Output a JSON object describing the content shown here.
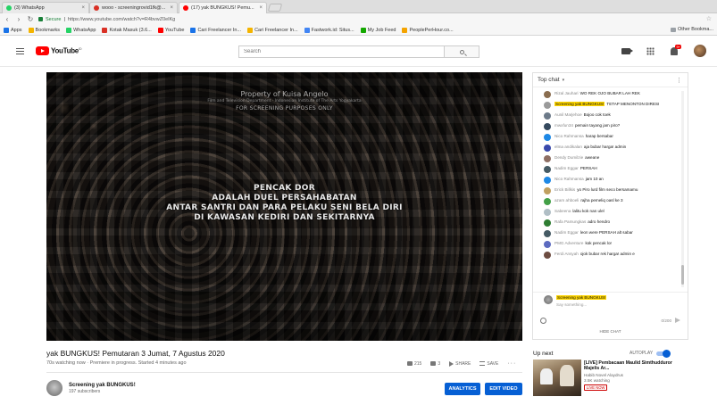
{
  "browser": {
    "tabs": [
      {
        "title": "(3) WhatsApp",
        "icon_color": "#25d366"
      },
      {
        "title": "wooo - screeningrovid1fk@...",
        "icon_color": "#d93025"
      },
      {
        "title": "(17) yak BUNGKUS! Pemu...",
        "icon_color": "#ff0000"
      }
    ],
    "tab_close": "×",
    "secure_label": "Secure",
    "url": "https://www.youtube.com/watch?v=R4bvwZ0elKg",
    "bookmarks": [
      {
        "label": "Apps",
        "icon_color": "#1a73e8"
      },
      {
        "label": "Bookmarks",
        "icon_color": "#f4b400"
      },
      {
        "label": "WhatsApp",
        "icon_color": "#25d366"
      },
      {
        "label": "Kotak Masuk (3.6...",
        "icon_color": "#d93025"
      },
      {
        "label": "YouTube",
        "icon_color": "#ff0000"
      },
      {
        "label": "Cari Freelancer In...",
        "icon_color": "#1a73e8"
      },
      {
        "label": "Cari Freelancer In...",
        "icon_color": "#f4b400"
      },
      {
        "label": "Fastwork.id: Situs...",
        "icon_color": "#4285f4"
      },
      {
        "label": "My Job Feed",
        "icon_color": "#14a800"
      },
      {
        "label": "PeoplePerHour.co...",
        "icon_color": "#f4a300"
      }
    ],
    "other_bookmarks": "Other Bookma..."
  },
  "masthead": {
    "logo_text": "YouTube",
    "logo_sup": "ID",
    "search_placeholder": "Search",
    "notifications_count": "9+"
  },
  "player": {
    "watermark_line1": "Property of Kuisa Angelo",
    "watermark_line2": "Film and Television Department · Indonesian Institute of The Arts Yogyakarta",
    "watermark_line3": "FOR SCREENING PURPOSES ONLY",
    "caption_lines": [
      "PENCAK DOR",
      "ADALAH DUEL PERSAHABATAN",
      "ANTAR SANTRI DAN PARA PELAKU SENI BELA DIRI",
      "DI KAWASAN KEDIRI DAN SEKITARNYA"
    ]
  },
  "video": {
    "title": "yak BUNGKUS! Pemutaran 3 Jumat, 7 Agustus 2020",
    "meta": "70s watching now · Premiere in progress. Started 4 minutes ago",
    "likes": "215",
    "dislikes": "3",
    "share_label": "SHARE",
    "save_label": "SAVE",
    "more_label": "···"
  },
  "channel": {
    "name": "Screening yak BUNGKUS!",
    "subscribers": "197 subscribers",
    "analytics_label": "ANALYTICS",
    "edit_label": "EDIT VIDEO"
  },
  "chat": {
    "header": "Top chat",
    "caret": "▾",
    "kebab": "⋮",
    "messages": [
      {
        "author": "Rizal Jauhari",
        "text": "WO REK OJO BUBAR LAH REK",
        "owner": false,
        "avatar": "#8a6d4f"
      },
      {
        "author": "Screening yak BUNGKUS!",
        "text": "TETAP MENONTON DIRESI",
        "owner": true,
        "avatar": "#9a9a9a"
      },
      {
        "author": "Aunil Marjehoe",
        "text": "Bojoo cok toek",
        "owner": false,
        "avatar": "#6c7a89"
      },
      {
        "author": "mwxfun34",
        "text": "pemain tayang jam piro?",
        "owner": false,
        "avatar": "#35495e"
      },
      {
        "author": "Nico Rahmansa",
        "text": "harap bersabar",
        "owner": false,
        "avatar": "#1e88e5"
      },
      {
        "author": "elma andikalan",
        "text": "aja bubar harga! admin",
        "owner": false,
        "avatar": "#3949ab"
      },
      {
        "author": "Dendy Dumilzie",
        "text": "aweane",
        "owner": false,
        "avatar": "#8d6e63"
      },
      {
        "author": "Nadim Eggar",
        "text": "PERSAH",
        "owner": false,
        "avatar": "#455a64"
      },
      {
        "author": "Nico Rahmansa",
        "text": "jam 10 an",
        "owner": false,
        "avatar": "#1e88e5"
      },
      {
        "author": "Erick Billkis",
        "text": "yo Piro lurd film seco bersamamu",
        "owner": false,
        "avatar": "#c0a060"
      },
      {
        "author": "azam ahboeli",
        "text": "rajha pemeliq oasl ke 3",
        "owner": false,
        "avatar": "#43a047"
      },
      {
        "author": "Sabeena",
        "text": "lalitu kok nan ulel",
        "owner": false,
        "avatar": "#b0bec5"
      },
      {
        "author": "Rafa Pamungkas",
        "text": "adro hendro",
        "owner": false,
        "avatar": "#2e7d32"
      },
      {
        "author": "Nadim Eggar",
        "text": "leon were PERSAH alt sabar",
        "owner": false,
        "avatar": "#455a64"
      },
      {
        "author": "PMG Adventure",
        "text": "kok pencak lor",
        "owner": false,
        "avatar": "#5c6bc0"
      },
      {
        "author": "Ferdi Ansyah",
        "text": "ojok bubar rek harga! admin e",
        "owner": false,
        "avatar": "#6d4c41"
      }
    ],
    "pinned_author": "Screening yak BUNGKUS!",
    "input_placeholder": "Say something...",
    "counter": "0/200",
    "hide_label": "HIDE CHAT"
  },
  "upnext": {
    "label": "Up next",
    "autoplay_label": "AUTOPLAY",
    "rec_title": "[LIVE] Pembacaan Maulid Simthudduror Majelis Ar...",
    "rec_channel": "Habib Novel Alaydrus",
    "rec_watching": "3.5K watching",
    "rec_badge": "LIVE NOW"
  }
}
